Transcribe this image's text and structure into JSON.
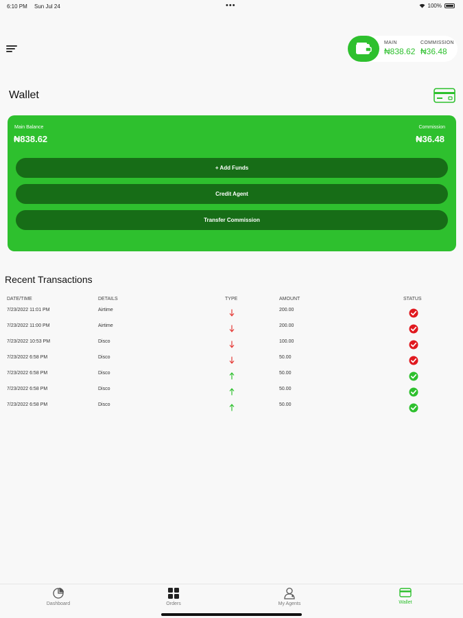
{
  "status_bar": {
    "time": "6:10 PM",
    "date": "Sun Jul 24",
    "dots": "•••",
    "battery": "100%"
  },
  "header_chip": {
    "main_label": "MAIN",
    "main_value": "₦838.62",
    "commission_label": "COMMISSION",
    "commission_value": "₦36.48"
  },
  "page": {
    "title": "Wallet"
  },
  "balance_card": {
    "main_label": "Main Balance",
    "main_value": "₦838.62",
    "commission_label": "Commission",
    "commission_value": "₦36.48",
    "buttons": [
      "+ Add Funds",
      "Credit Agent",
      "Transfer Commission"
    ]
  },
  "transactions": {
    "title": "Recent Transactions",
    "headers": [
      "DATE/TIME",
      "DETAILS",
      "TYPE",
      "AMOUNT",
      "STATUS"
    ],
    "rows": [
      {
        "date": "7/23/2022 11:01 PM",
        "details": "Airtime",
        "type": "debit",
        "amount": "200.00",
        "status": "failed"
      },
      {
        "date": "7/23/2022 11:00 PM",
        "details": "Airtime",
        "type": "debit",
        "amount": "200.00",
        "status": "failed"
      },
      {
        "date": "7/23/2022 10:53 PM",
        "details": "Disco",
        "type": "debit",
        "amount": "100.00",
        "status": "failed"
      },
      {
        "date": "7/23/2022 6:58 PM",
        "details": "Disco",
        "type": "debit",
        "amount": "50.00",
        "status": "failed"
      },
      {
        "date": "7/23/2022 6:58 PM",
        "details": "Disco",
        "type": "credit",
        "amount": "50.00",
        "status": "success"
      },
      {
        "date": "7/23/2022 6:58 PM",
        "details": "Disco",
        "type": "credit",
        "amount": "50.00",
        "status": "success"
      },
      {
        "date": "7/23/2022 6:58 PM",
        "details": "Disco",
        "type": "credit",
        "amount": "50.00",
        "status": "success"
      }
    ]
  },
  "tabbar": {
    "tabs": [
      {
        "label": "Dashboard",
        "icon": "pie-chart-icon"
      },
      {
        "label": "Orders",
        "icon": "grid-icon"
      },
      {
        "label": "My Agents",
        "icon": "agent-icon"
      },
      {
        "label": "Wallet",
        "icon": "wallet-card-icon",
        "active": true
      }
    ]
  },
  "colors": {
    "accent": "#2ec02e",
    "button_dark": "#176d17",
    "debit": "#e53935",
    "status_fail": "#e0191f",
    "status_ok": "#2ec02e"
  }
}
